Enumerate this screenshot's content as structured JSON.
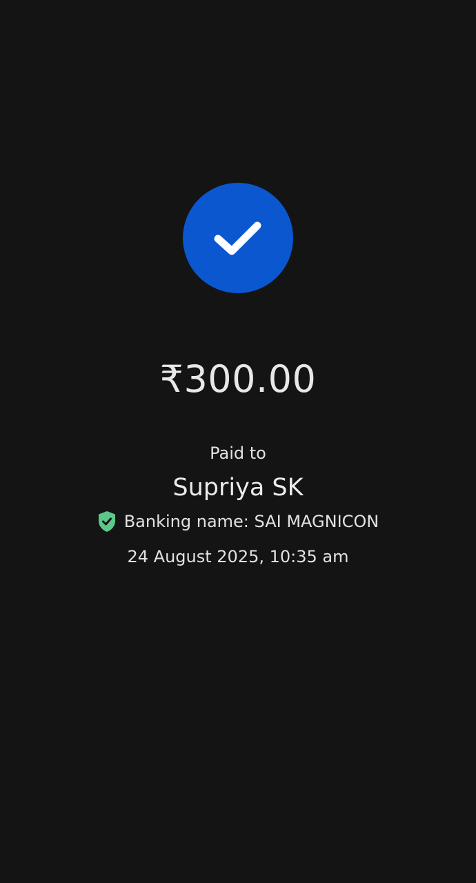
{
  "payment": {
    "status_icon": "checkmark-icon",
    "amount": "₹300.00",
    "paid_to_label": "Paid to",
    "payee_name": "Supriya SK",
    "verified_icon": "verified-shield-icon",
    "banking_name": "Banking name: SAI MAGNICON",
    "datetime": "24 August 2025, 10:35 am"
  },
  "colors": {
    "background": "#141414",
    "success_circle": "#0b57d0",
    "verified_shield": "#5bc88a",
    "text": "#e6e6e6"
  }
}
